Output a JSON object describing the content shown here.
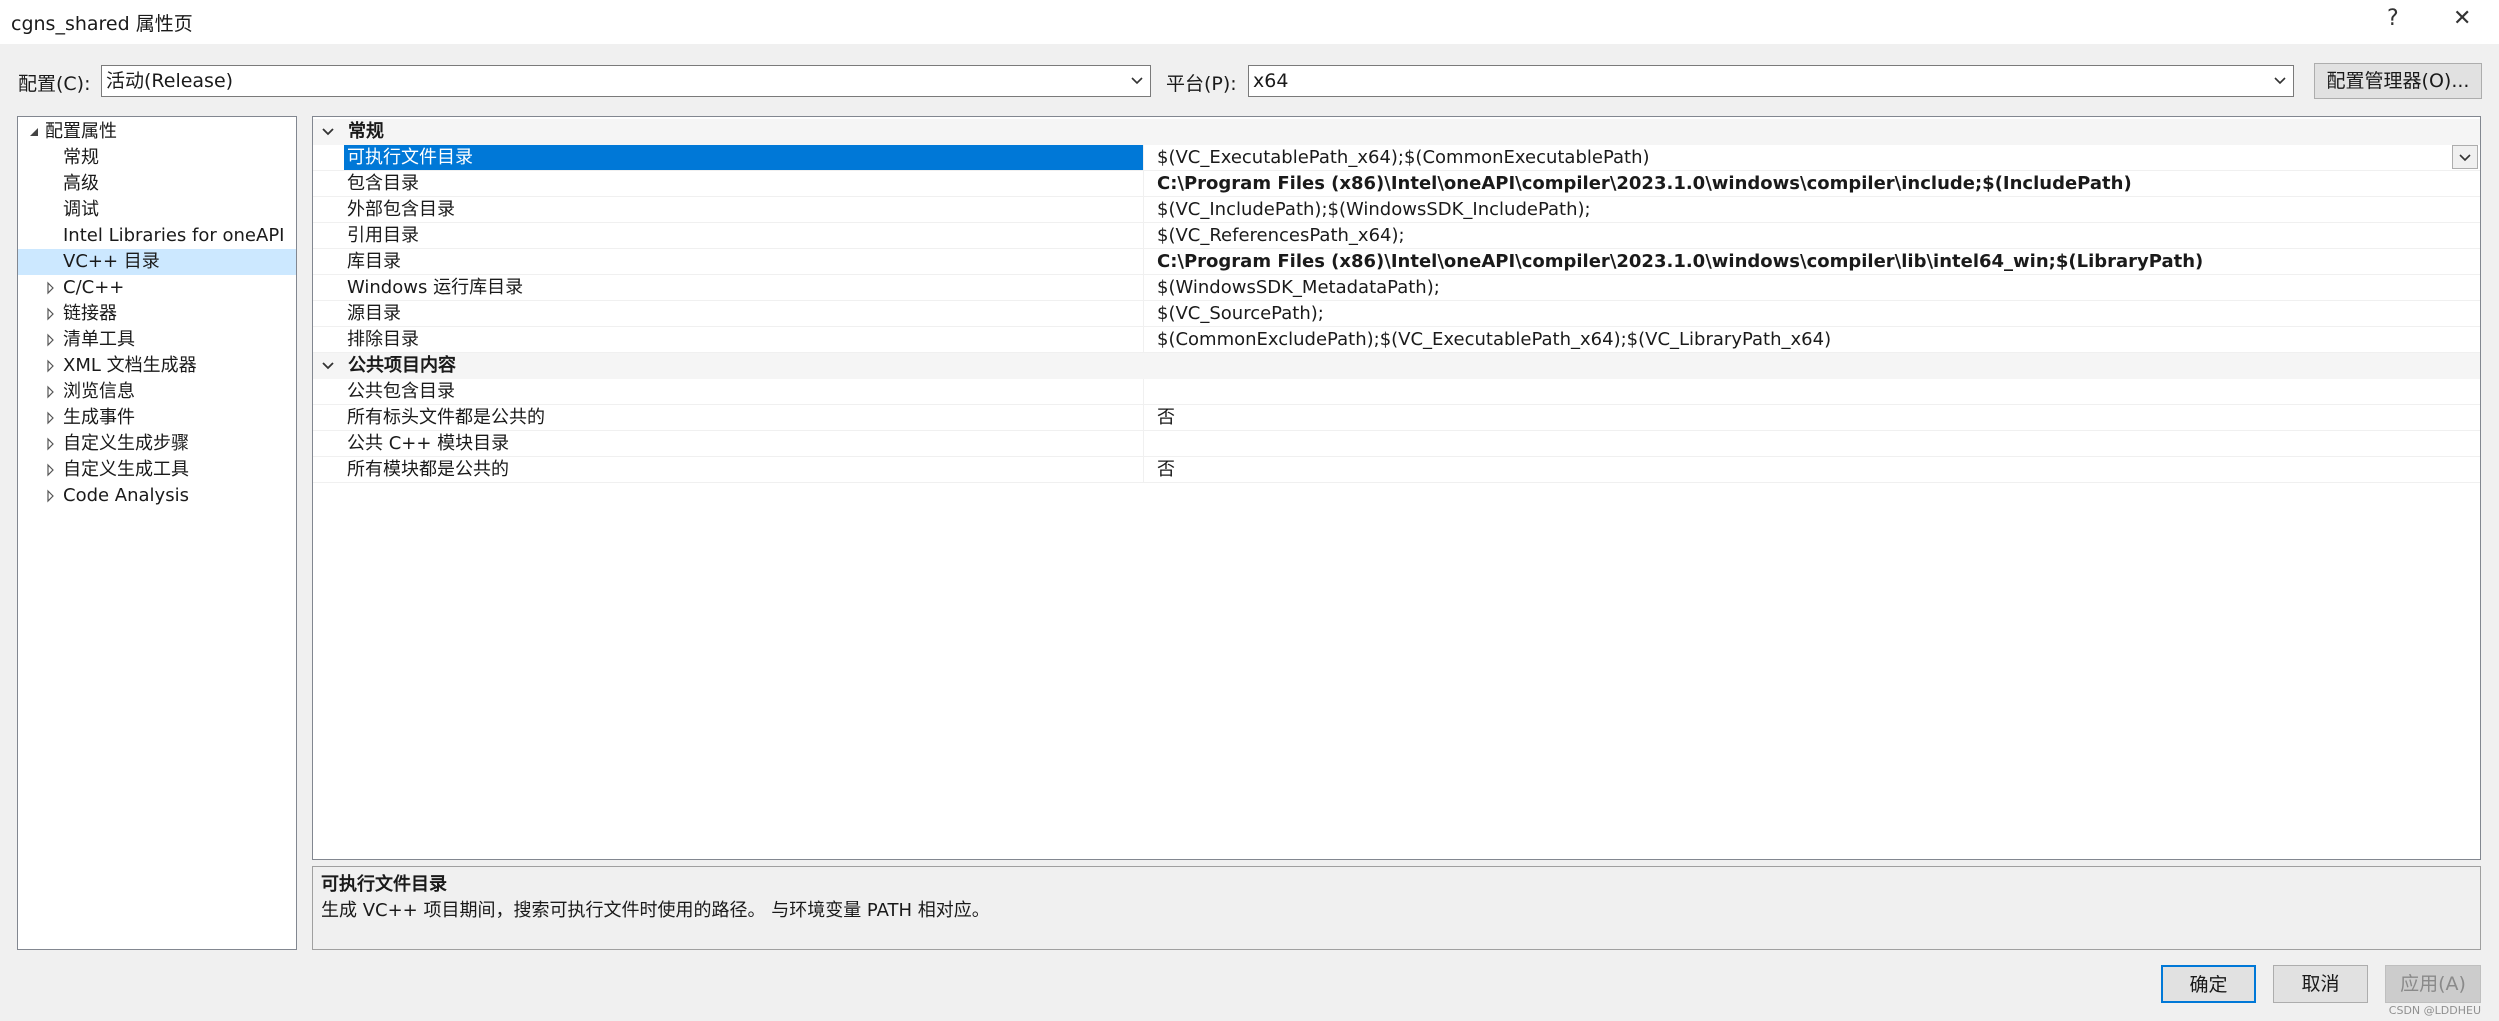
{
  "window": {
    "title": "cgns_shared 属性页",
    "help_label": "?",
    "close_label": "✕"
  },
  "config_bar": {
    "config_label": "配置(C):",
    "config_value": "活动(Release)",
    "platform_label": "平台(P):",
    "platform_value": "x64",
    "config_manager_label": "配置管理器(O)..."
  },
  "tree": {
    "items": [
      {
        "label": "配置属性",
        "expander": "expanded",
        "level": 0,
        "selected": false
      },
      {
        "label": "常规",
        "expander": "none",
        "level": 1,
        "selected": false
      },
      {
        "label": "高级",
        "expander": "none",
        "level": 1,
        "selected": false
      },
      {
        "label": "调试",
        "expander": "none",
        "level": 1,
        "selected": false
      },
      {
        "label": "Intel Libraries for oneAPI",
        "expander": "none",
        "level": 1,
        "selected": false
      },
      {
        "label": "VC++ 目录",
        "expander": "none",
        "level": 1,
        "selected": true
      },
      {
        "label": "C/C++",
        "expander": "collapsed",
        "level": 1,
        "selected": false
      },
      {
        "label": "链接器",
        "expander": "collapsed",
        "level": 1,
        "selected": false
      },
      {
        "label": "清单工具",
        "expander": "collapsed",
        "level": 1,
        "selected": false
      },
      {
        "label": "XML 文档生成器",
        "expander": "collapsed",
        "level": 1,
        "selected": false
      },
      {
        "label": "浏览信息",
        "expander": "collapsed",
        "level": 1,
        "selected": false
      },
      {
        "label": "生成事件",
        "expander": "collapsed",
        "level": 1,
        "selected": false
      },
      {
        "label": "自定义生成步骤",
        "expander": "collapsed",
        "level": 1,
        "selected": false
      },
      {
        "label": "自定义生成工具",
        "expander": "collapsed",
        "level": 1,
        "selected": false
      },
      {
        "label": "Code Analysis",
        "expander": "collapsed",
        "level": 1,
        "selected": false
      }
    ]
  },
  "grid": {
    "categories": [
      {
        "label": "常规",
        "rows": [
          {
            "name": "可执行文件目录",
            "value": "$(VC_ExecutablePath_x64);$(CommonExecutablePath)",
            "bold": false,
            "selected": true
          },
          {
            "name": "包含目录",
            "value": "C:\\Program Files (x86)\\Intel\\oneAPI\\compiler\\2023.1.0\\windows\\compiler\\include;$(IncludePath)",
            "bold": true,
            "selected": false
          },
          {
            "name": "外部包含目录",
            "value": "$(VC_IncludePath);$(WindowsSDK_IncludePath);",
            "bold": false,
            "selected": false
          },
          {
            "name": "引用目录",
            "value": "$(VC_ReferencesPath_x64);",
            "bold": false,
            "selected": false
          },
          {
            "name": "库目录",
            "value": "C:\\Program Files (x86)\\Intel\\oneAPI\\compiler\\2023.1.0\\windows\\compiler\\lib\\intel64_win;$(LibraryPath)",
            "bold": true,
            "selected": false
          },
          {
            "name": "Windows 运行库目录",
            "value": "$(WindowsSDK_MetadataPath);",
            "bold": false,
            "selected": false
          },
          {
            "name": "源目录",
            "value": "$(VC_SourcePath);",
            "bold": false,
            "selected": false
          },
          {
            "name": "排除目录",
            "value": "$(CommonExcludePath);$(VC_ExecutablePath_x64);$(VC_LibraryPath_x64)",
            "bold": false,
            "selected": false
          }
        ]
      },
      {
        "label": "公共项目内容",
        "rows": [
          {
            "name": "公共包含目录",
            "value": "",
            "bold": false,
            "selected": false
          },
          {
            "name": "所有标头文件都是公共的",
            "value": "否",
            "bold": false,
            "selected": false
          },
          {
            "name": "公共 C++ 模块目录",
            "value": "",
            "bold": false,
            "selected": false
          },
          {
            "name": "所有模块都是公共的",
            "value": "否",
            "bold": false,
            "selected": false
          }
        ]
      }
    ]
  },
  "description": {
    "title": "可执行文件目录",
    "text": "生成 VC++ 项目期间，搜索可执行文件时使用的路径。 与环境变量 PATH 相对应。"
  },
  "buttons": {
    "ok_label": "确定",
    "cancel_label": "取消",
    "apply_label": "应用(A)"
  },
  "watermark": "CSDN @LDDHEU",
  "colors": {
    "selection": "#0078d7",
    "tree_selection": "#cce8ff",
    "default_button_border": "#0078d7"
  }
}
